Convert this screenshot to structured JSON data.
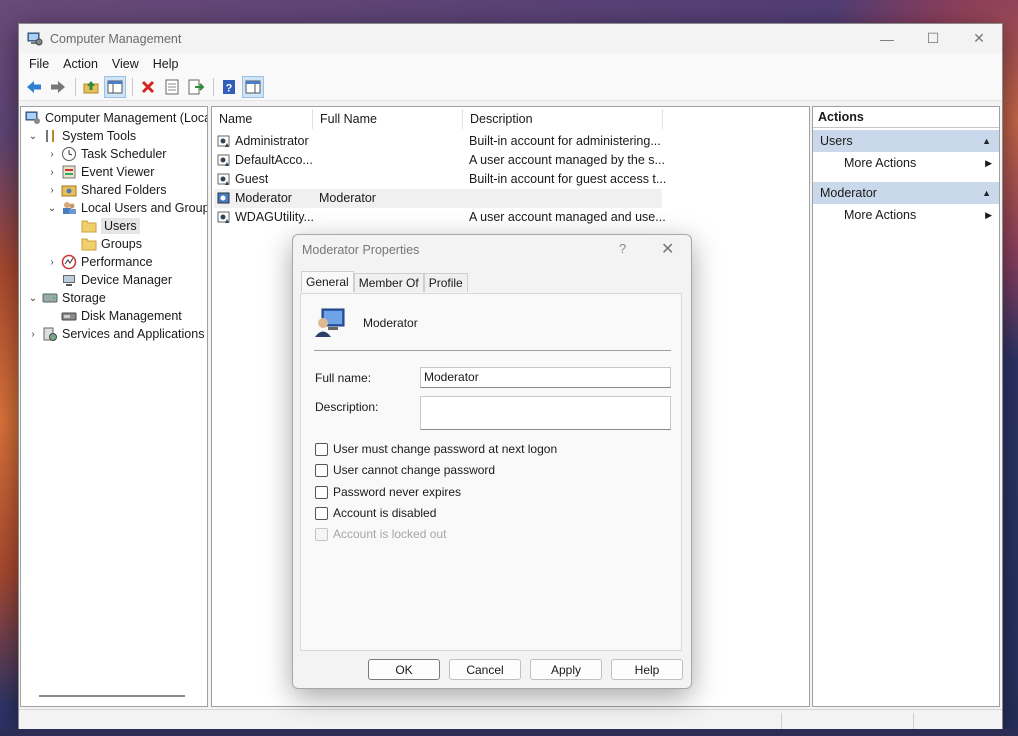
{
  "window": {
    "title": "Computer Management"
  },
  "menu": [
    "File",
    "Action",
    "View",
    "Help"
  ],
  "toolbar_icons": [
    "back-icon",
    "forward-icon",
    "up-folder-icon",
    "show-hide-tree-icon",
    "delete-icon",
    "properties-icon",
    "export-icon",
    "help-icon",
    "show-hide-action-pane-icon"
  ],
  "tree": {
    "root": "Computer Management (Local",
    "system_tools": "System Tools",
    "task_scheduler": "Task Scheduler",
    "event_viewer": "Event Viewer",
    "shared_folders": "Shared Folders",
    "local_users_groups": "Local Users and Groups",
    "users": "Users",
    "groups": "Groups",
    "performance": "Performance",
    "device_manager": "Device Manager",
    "storage": "Storage",
    "disk_management": "Disk Management",
    "services_apps": "Services and Applications"
  },
  "list": {
    "columns": [
      "Name",
      "Full Name",
      "Description"
    ],
    "rows": [
      {
        "name": "Administrator",
        "full_name": "",
        "description": "Built-in account for administering..."
      },
      {
        "name": "DefaultAcco...",
        "full_name": "",
        "description": "A user account managed by the s..."
      },
      {
        "name": "Guest",
        "full_name": "",
        "description": "Built-in account for guest access t..."
      },
      {
        "name": "Moderator",
        "full_name": "Moderator",
        "description": ""
      },
      {
        "name": "WDAGUtility...",
        "full_name": "",
        "description": "A user account managed and use..."
      }
    ]
  },
  "actions": {
    "header": "Actions",
    "sections": [
      {
        "title": "Users",
        "item": "More Actions"
      },
      {
        "title": "Moderator",
        "item": "More Actions"
      }
    ]
  },
  "dialog": {
    "title": "Moderator Properties",
    "help_glyph": "?",
    "close_glyph": "✕",
    "tabs": [
      "General",
      "Member Of",
      "Profile"
    ],
    "user_name": "Moderator",
    "full_name_label": "Full name:",
    "full_name_value": "Moderator",
    "description_label": "Description:",
    "description_value": "",
    "checkboxes": [
      {
        "label": "User must change password at next logon",
        "checked": false,
        "enabled": true
      },
      {
        "label": "User cannot change password",
        "checked": false,
        "enabled": true
      },
      {
        "label": "Password never expires",
        "checked": false,
        "enabled": true
      },
      {
        "label": "Account is disabled",
        "checked": false,
        "enabled": true
      },
      {
        "label": "Account is locked out",
        "checked": false,
        "enabled": false
      }
    ],
    "buttons": [
      "OK",
      "Cancel",
      "Apply",
      "Help"
    ]
  },
  "colors": {
    "accent_section": "#c9d8ea",
    "selection": "#e5e5e5"
  }
}
